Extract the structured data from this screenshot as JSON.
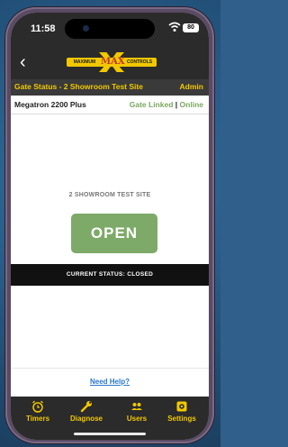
{
  "status_bar": {
    "time": "11:58",
    "battery": "80"
  },
  "header": {
    "logo": {
      "left": "MAXIMUM",
      "center": "MAX",
      "right": "CONTROLS"
    }
  },
  "gate_bar": {
    "title": "Gate Status - 2 Showroom Test Site",
    "role": "Admin"
  },
  "device_bar": {
    "name": "Megatron 2200 Plus",
    "linked": "Gate Linked",
    "separator": "|",
    "online": "Online"
  },
  "main": {
    "site_name": "2 SHOWROOM TEST SITE",
    "open_label": "OPEN",
    "current_status": "CURRENT STATUS: CLOSED"
  },
  "help": {
    "label": "Need Help?"
  },
  "tabs": [
    {
      "label": "Timers",
      "icon": "alarm-clock-icon"
    },
    {
      "label": "Diagnose",
      "icon": "wrench-icon"
    },
    {
      "label": "Users",
      "icon": "users-icon"
    },
    {
      "label": "Settings",
      "icon": "gear-icon"
    }
  ],
  "colors": {
    "accent": "#f2c800",
    "open_button": "#7daa68",
    "online": "#7aa860",
    "link": "#2b78c8"
  }
}
